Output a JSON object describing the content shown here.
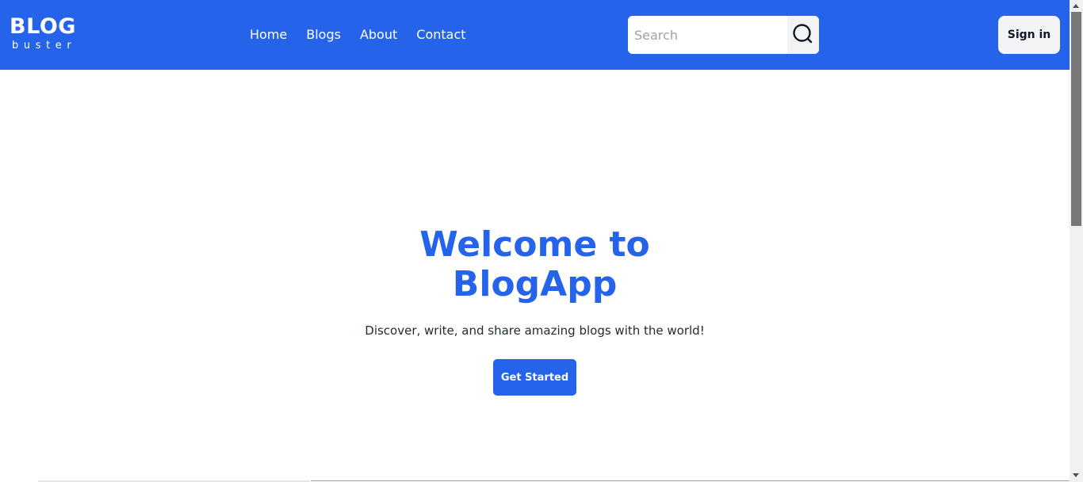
{
  "brand": {
    "title": "BLOG",
    "subtitle": "buster"
  },
  "nav": {
    "links": [
      {
        "label": "Home"
      },
      {
        "label": "Blogs"
      },
      {
        "label": "About"
      },
      {
        "label": "Contact"
      }
    ]
  },
  "search": {
    "placeholder": "Search",
    "value": "",
    "icon": "search-icon"
  },
  "auth": {
    "signin_label": "Sign in"
  },
  "hero": {
    "title_line1": "Welcome to",
    "title_line2": "BlogApp",
    "subtitle": "Discover, write, and share amazing blogs with the world!",
    "cta_label": "Get Started"
  },
  "colors": {
    "brand_blue": "#2563eb",
    "button_gray": "#f3f4f6",
    "text_dark": "#1f2937"
  }
}
